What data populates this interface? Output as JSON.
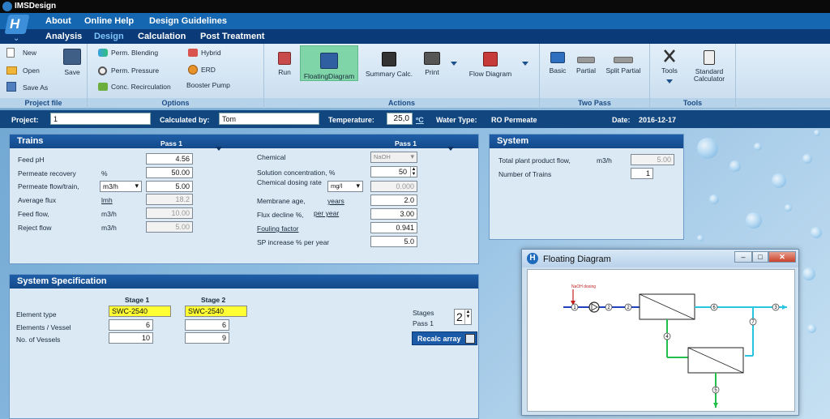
{
  "app": {
    "title": "IMSDesign"
  },
  "menu_top": [
    "About",
    "Online Help",
    "Design Guidelines"
  ],
  "menu_main": [
    "Analysis",
    "Design",
    "Calculation",
    "Post Treatment"
  ],
  "menu_main_active": "Design",
  "ribbon": {
    "project_file": {
      "new": "New",
      "open": "Open",
      "save_as": "Save As",
      "save": "Save",
      "label": "Project file"
    },
    "options": {
      "perm_blending": "Perm. Blending",
      "perm_pressure": "Perm. Pressure",
      "conc_recirculation": "Conc. Recirculation",
      "hybrid": "Hybrid",
      "erd": "ERD",
      "booster_pump": "Booster Pump",
      "label": "Options"
    },
    "actions": {
      "run": "Run",
      "floating_diagram": "FloatingDiagram",
      "summary_calc": "Summary Calc.",
      "print": "Print",
      "flow_diagram": "Flow Diagram",
      "label": "Actions"
    },
    "two_pass": {
      "basic": "Basic",
      "partial": "Partial",
      "split_partial": "Split Partial",
      "label": "Two Pass"
    },
    "tools": {
      "tools": "Tools",
      "standard_calculator": "Standard Calculator",
      "label": "Tools"
    }
  },
  "project_bar": {
    "project_label": "Project:",
    "project_value": "1",
    "calculated_by_label": "Calculated by:",
    "calculated_by_value": "Tom",
    "temperature_label": "Temperature:",
    "temperature_value": "25,0",
    "temperature_unit": "ºC",
    "water_type_label": "Water Type:",
    "water_type_value": "RO Permeate",
    "date_label": "Date:",
    "date_value": "2016-12-17"
  },
  "trains": {
    "title": "Trains",
    "pass_label": "Pass 1",
    "feed_ph": {
      "label": "Feed pH",
      "value": "4.56"
    },
    "permeate_recovery": {
      "label": "Permeate recovery",
      "unit": "%",
      "value": "50.00"
    },
    "permeate_flow": {
      "label": "Permeate flow/train,",
      "unit": "m3/h",
      "value": "5.00"
    },
    "average_flux": {
      "label": "Average flux",
      "unit": "lmh",
      "value": "18.2"
    },
    "feed_flow": {
      "label": "Feed flow,",
      "unit": "m3/h",
      "value": "10.00"
    },
    "reject_flow": {
      "label": "Reject flow",
      "unit": "m3/h",
      "value": "5.00"
    },
    "pass2_label": "Pass 1",
    "chemical": {
      "label": "Chemical",
      "value": "NaOH"
    },
    "solution_concentration": {
      "label": "Solution concentration, %",
      "value": "50"
    },
    "chemical_dosing_rate": {
      "label": "Chemical dosing rate",
      "unit": "mg/l",
      "value": "0.000"
    },
    "membrane_age": {
      "label": "Membrane age,",
      "unit": "years",
      "value": "2.0"
    },
    "flux_decline": {
      "label": "Flux decline %,",
      "unit": "per year",
      "value": "3.00"
    },
    "fouling_factor": {
      "label": "Fouling factor",
      "value": "0.941"
    },
    "sp_increase": {
      "label": "SP increase % per year",
      "value": "5.0"
    }
  },
  "system": {
    "title": "System",
    "total_flow": {
      "label": "Total plant product flow,",
      "unit": "m3/h",
      "value": "5.00"
    },
    "num_trains": {
      "label": "Number of Trains",
      "value": "1"
    }
  },
  "system_spec": {
    "title": "System Specification",
    "stage1_label": "Stage 1",
    "stage2_label": "Stage 2",
    "element_type_label": "Element type",
    "elements_vessel_label": "Elements / Vessel",
    "num_vessels_label": "No. of Vessels",
    "stage1": {
      "element_type": "SWC-2540",
      "elements_vessel": "6",
      "num_vessels": "10"
    },
    "stage2": {
      "element_type": "SWC-2540",
      "elements_vessel": "6",
      "num_vessels": "9"
    },
    "stages_label": "Stages",
    "stages_value": "2",
    "pass_label": "Pass 1",
    "recalc_button": "Recalc array"
  },
  "floating_window": {
    "title": "Floating Diagram",
    "dosing_label": "NaOH dosing",
    "nodes": [
      "1",
      "2",
      "2",
      "3",
      "4",
      "5",
      "6",
      "7"
    ]
  },
  "colors": {
    "accent_dark": "#0b3a78",
    "accent_mid": "#1467b0",
    "panel_bg": "#dbe9f5",
    "active_ribbon": "#7fd4a8",
    "highlight_yellow": "#ffff33"
  }
}
